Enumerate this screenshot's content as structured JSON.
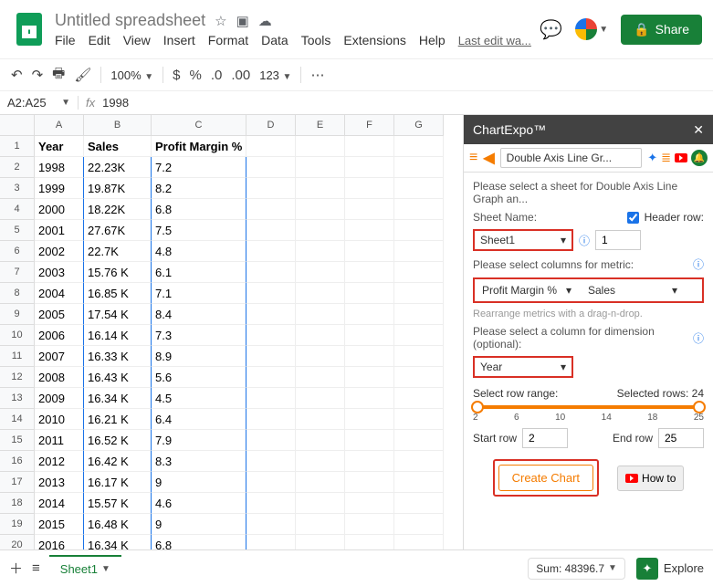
{
  "header": {
    "title": "Untitled spreadsheet",
    "menus": [
      "File",
      "Edit",
      "View",
      "Insert",
      "Format",
      "Data",
      "Tools",
      "Extensions",
      "Help"
    ],
    "last_edit": "Last edit wa...",
    "share": "Share"
  },
  "toolbar": {
    "zoom": "100%",
    "fmt_num": "123"
  },
  "cellref": {
    "range": "A2:A25",
    "fx": "1998"
  },
  "columns_letters": [
    "A",
    "B",
    "C",
    "D",
    "E",
    "F",
    "G"
  ],
  "table": {
    "headers": [
      "Year",
      "Sales",
      "Profit Margin %"
    ],
    "rows": [
      [
        "1998",
        "22.23K",
        "7.2"
      ],
      [
        "1999",
        "19.87K",
        "8.2"
      ],
      [
        "2000",
        "18.22K",
        "6.8"
      ],
      [
        "2001",
        "27.67K",
        "7.5"
      ],
      [
        "2002",
        "22.7K",
        "4.8"
      ],
      [
        "2003",
        "15.76 K",
        "6.1"
      ],
      [
        "2004",
        "16.85 K",
        "7.1"
      ],
      [
        "2005",
        "17.54 K",
        "8.4"
      ],
      [
        "2006",
        "16.14 K",
        "7.3"
      ],
      [
        "2007",
        "16.33 K",
        "8.9"
      ],
      [
        "2008",
        "16.43 K",
        "5.6"
      ],
      [
        "2009",
        "16.34 K",
        "4.5"
      ],
      [
        "2010",
        "16.21 K",
        "6.4"
      ],
      [
        "2011",
        "16.52 K",
        "7.9"
      ],
      [
        "2012",
        "16.42 K",
        "8.3"
      ],
      [
        "2013",
        "16.17 K",
        "9"
      ],
      [
        "2014",
        "15.57 K",
        "4.6"
      ],
      [
        "2015",
        "16.48 K",
        "9"
      ],
      [
        "2016",
        "16.34 K",
        "6.8"
      ]
    ]
  },
  "panel": {
    "title": "ChartExpo™",
    "breadcrumb": "Double Axis Line Gr...",
    "select_sheet_msg": "Please select a sheet for Double Axis Line Graph an...",
    "sheet_name_label": "Sheet Name:",
    "header_row_label": "Header row:",
    "sheet_select": "Sheet1",
    "header_row_value": "1",
    "select_cols_msg": "Please select columns for metric:",
    "metric1": "Profit Margin %",
    "metric2": "Sales",
    "rearrange_msg": "Rearrange metrics with a drag-n-drop.",
    "select_dim_msg": "Please select a column for dimension (optional):",
    "dimension": "Year",
    "range_label": "Select row range:",
    "selected_rows": "Selected rows: 24",
    "ticks": [
      "2",
      "6",
      "10",
      "14",
      "18",
      "25"
    ],
    "start_label": "Start row",
    "start_val": "2",
    "end_label": "End row",
    "end_val": "25",
    "create_btn": "Create Chart",
    "howto_btn": "How to"
  },
  "footer": {
    "sheet": "Sheet1",
    "sum": "Sum: 48396.7",
    "explore": "Explore"
  }
}
